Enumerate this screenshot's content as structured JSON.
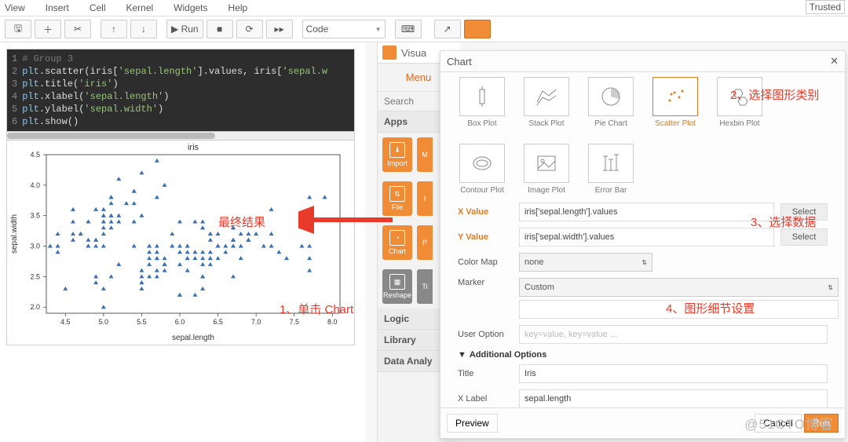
{
  "menu": {
    "view": "View",
    "insert": "Insert",
    "cell": "Cell",
    "kernel": "Kernel",
    "widgets": "Widgets",
    "help": "Help",
    "trusted": "Trusted"
  },
  "toolbar": {
    "run": "▶ Run",
    "mode": "Code",
    "save": "💾",
    "add": "＋",
    "cut": "✂",
    "up": "↑",
    "down": "↓",
    "stop": "■",
    "restart": "⟳",
    "ff": "▸▸",
    "kb": "⌘",
    "cmd": "⌘"
  },
  "code": {
    "l1": "# Group 3",
    "l2a": "plt",
    "l2b": ".scatter(iris[",
    "l2c": "'sepal.length'",
    "l2d": "].values, iris[",
    "l2e": "'sepal.w",
    "l3a": "plt",
    "l3b": ".title(",
    "l3c": "'iris'",
    "l3d": ")",
    "l4a": "plt",
    "l4b": ".xlabel(",
    "l4c": "'sepal.length'",
    "l4d": ")",
    "l5a": "plt",
    "l5b": ".ylabel(",
    "l5c": "'sepal.width'",
    "l5d": ")",
    "l6a": "plt",
    "l6b": ".show()"
  },
  "chart_data": {
    "type": "scatter",
    "title": "iris",
    "xlabel": "sepal.length",
    "ylabel": "sepal.width",
    "xlim": [
      4.25,
      8.1
    ],
    "ylim": [
      1.9,
      4.5
    ],
    "xticks": [
      4.5,
      5.0,
      5.5,
      6.0,
      6.5,
      7.0,
      7.5,
      8.0
    ],
    "yticks": [
      2.0,
      2.5,
      3.0,
      3.5,
      4.0,
      4.5
    ],
    "x": [
      5.1,
      4.9,
      4.7,
      4.6,
      5.0,
      5.4,
      4.6,
      5.0,
      4.4,
      4.9,
      5.4,
      4.8,
      4.8,
      4.3,
      5.8,
      5.7,
      5.4,
      5.1,
      5.7,
      5.1,
      5.4,
      5.1,
      4.6,
      5.1,
      4.8,
      5.0,
      5.0,
      5.2,
      5.2,
      4.7,
      4.8,
      5.4,
      5.2,
      5.5,
      4.9,
      5.0,
      5.5,
      4.9,
      4.4,
      5.1,
      5.0,
      4.5,
      4.4,
      5.0,
      5.1,
      4.8,
      5.1,
      4.6,
      5.3,
      5.0,
      7.0,
      6.4,
      6.9,
      5.5,
      6.5,
      5.7,
      6.3,
      4.9,
      6.6,
      5.2,
      5.0,
      5.9,
      6.0,
      6.1,
      5.6,
      6.7,
      5.6,
      5.8,
      6.2,
      5.6,
      5.9,
      6.1,
      6.3,
      6.1,
      6.4,
      6.6,
      6.8,
      6.7,
      6.0,
      5.7,
      5.5,
      5.5,
      5.8,
      6.0,
      5.4,
      6.0,
      6.7,
      6.3,
      5.6,
      5.5,
      5.5,
      6.1,
      5.8,
      5.0,
      5.6,
      5.7,
      5.7,
      6.2,
      5.1,
      5.7,
      6.3,
      5.8,
      7.1,
      6.3,
      6.5,
      7.6,
      4.9,
      7.3,
      6.7,
      7.2,
      6.5,
      6.4,
      6.8,
      5.7,
      5.8,
      6.4,
      6.5,
      7.7,
      7.7,
      6.0,
      6.9,
      5.6,
      7.7,
      6.3,
      6.7,
      7.2,
      6.2,
      6.1,
      6.4,
      7.2,
      7.4,
      7.9,
      6.4,
      6.3,
      6.1,
      7.7,
      6.3,
      6.4,
      6.0,
      6.9,
      6.7,
      6.9,
      5.8,
      6.8,
      6.7,
      6.7,
      6.3,
      6.5,
      6.2,
      5.9
    ],
    "y": [
      3.5,
      3.0,
      3.2,
      3.1,
      3.6,
      3.9,
      3.4,
      3.4,
      2.9,
      3.1,
      3.7,
      3.4,
      3.0,
      3.0,
      4.0,
      4.4,
      3.9,
      3.5,
      3.8,
      3.8,
      3.4,
      3.7,
      3.6,
      3.3,
      3.4,
      3.0,
      3.4,
      3.5,
      3.4,
      3.2,
      3.1,
      3.4,
      4.1,
      4.2,
      3.1,
      3.2,
      3.5,
      3.6,
      3.0,
      3.4,
      3.5,
      2.3,
      3.2,
      3.5,
      3.8,
      3.0,
      3.8,
      3.2,
      3.7,
      3.3,
      3.2,
      3.2,
      3.1,
      2.3,
      2.8,
      2.8,
      3.3,
      2.4,
      2.9,
      2.7,
      2.0,
      3.0,
      2.2,
      2.9,
      2.9,
      3.1,
      3.0,
      2.7,
      2.2,
      2.5,
      3.2,
      2.8,
      2.5,
      2.8,
      2.9,
      3.0,
      2.8,
      3.0,
      2.9,
      2.6,
      2.4,
      2.4,
      2.7,
      2.7,
      3.0,
      3.4,
      3.1,
      2.3,
      3.0,
      2.5,
      2.6,
      3.0,
      2.6,
      2.3,
      2.7,
      3.0,
      2.9,
      2.9,
      2.5,
      2.8,
      3.3,
      2.7,
      3.0,
      2.9,
      3.0,
      3.0,
      2.5,
      2.9,
      2.5,
      3.6,
      3.2,
      2.7,
      3.0,
      2.5,
      2.8,
      3.2,
      3.0,
      3.8,
      2.6,
      2.2,
      3.2,
      2.8,
      2.8,
      2.7,
      3.3,
      3.2,
      2.8,
      3.0,
      2.8,
      3.0,
      2.8,
      3.8,
      2.8,
      2.8,
      2.6,
      3.0,
      3.4,
      3.1,
      3.0,
      3.1,
      3.1,
      3.1,
      2.7,
      3.2,
      3.3,
      3.0,
      2.5,
      3.0,
      3.4,
      3.0
    ]
  },
  "panel": {
    "brand": "Visua",
    "menu": "Menu",
    "search": "Search",
    "apps": "Apps",
    "tiles": {
      "import": "Import",
      "file": "File",
      "chart": "Chart",
      "reshape": "Reshape",
      "m": "M",
      "i": "I",
      "p": "P",
      "ti": "Ti"
    },
    "sections": {
      "logic": "Logic",
      "library": "Library",
      "da": "Data Analy"
    }
  },
  "chart_panel": {
    "title": "Chart",
    "types": {
      "box": "Box Plot",
      "stack": "Stack Plot",
      "pie": "Pie Chart",
      "scatter": "Scatter Plot",
      "hexbin": "Hexbin Plot",
      "contour": "Contour Plot",
      "image": "Image Plot",
      "error": "Error Bar"
    },
    "fields": {
      "xval": "X Value",
      "xval_v": "iris['sepal.length'].values",
      "yval": "Y Value",
      "yval_v": "iris['sepal.width'].values",
      "cmap": "Color Map",
      "cmap_v": "none",
      "marker": "Marker",
      "custom": "Custom",
      "uopt": "User Option",
      "uopt_p": "key=value, key=value ...",
      "addl": "Additional Options",
      "title": "Title",
      "title_v": "Iris",
      "xlabel": "X Label",
      "xlabel_v": "sepal.length",
      "select": "Select"
    },
    "buttons": {
      "preview": "Preview",
      "cancel": "Cancel",
      "run": "Run"
    }
  },
  "annot": {
    "a1": "1、单击 Chart",
    "a2": "2、选择图形类别",
    "a3": "3、选择数据",
    "a4": "4、图形细节设置",
    "a5": "最终结果"
  },
  "watermark": "@51CTO博客"
}
